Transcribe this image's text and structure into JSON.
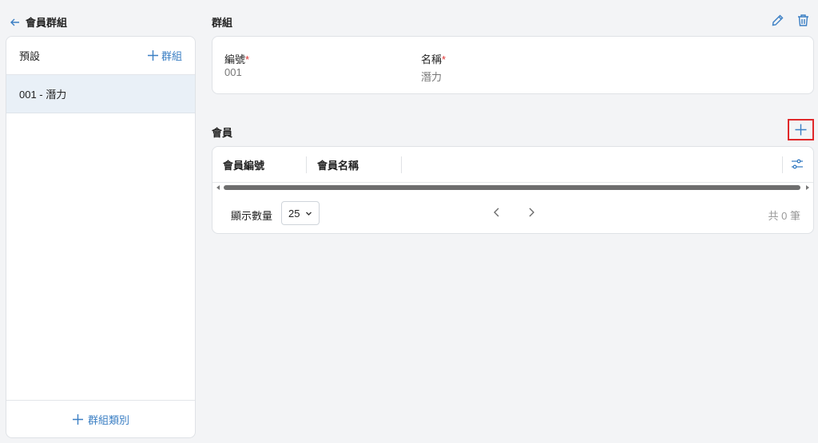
{
  "header": {
    "back_label": "會員群組"
  },
  "sidebar": {
    "section_label": "預設",
    "add_group_label": "群組",
    "items": [
      {
        "label": "001 - 潛力"
      }
    ],
    "add_category_label": "群組類別"
  },
  "group": {
    "title": "群組",
    "code_label": "編號",
    "code_value": "001",
    "name_label": "名稱",
    "name_value": "潛力",
    "required_mark": "*"
  },
  "members": {
    "title": "會員",
    "columns": [
      "會員編號",
      "會員名稱"
    ],
    "page_size_label": "顯示數量",
    "page_size_value": "25",
    "total_label": "共 0 筆"
  },
  "colors": {
    "accent": "#3b7fc4",
    "highlight_box": "#e0282a",
    "required": "#d33333"
  },
  "icons": [
    "back-arrow-icon",
    "plus-icon",
    "pencil-icon",
    "trash-icon",
    "filter-settings-icon",
    "chevron-down-icon",
    "chevron-left-icon",
    "chevron-right-icon"
  ]
}
